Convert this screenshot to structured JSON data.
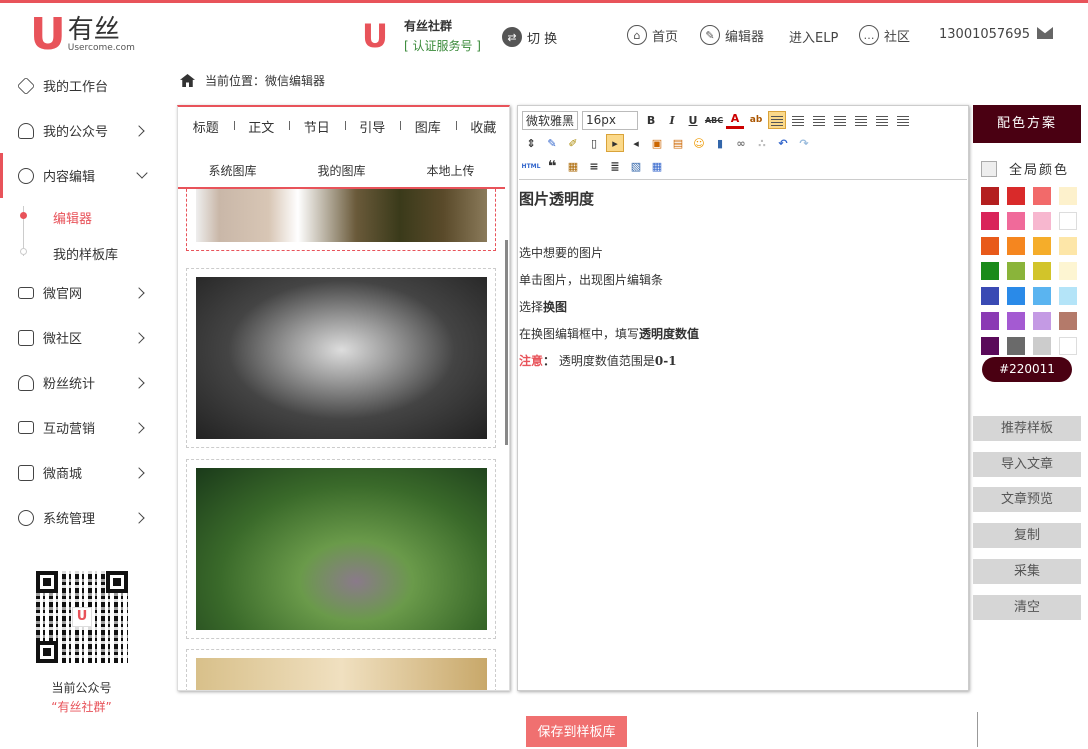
{
  "header": {
    "brand_cn": "有丝",
    "brand_en": "Usercome.com",
    "account_name": "有丝社群",
    "account_type": "[ 认证服务号 ]",
    "switch_label": "切 换",
    "nav": [
      "首页",
      "编辑器",
      "进入ELP",
      "社区"
    ],
    "phone": "13001057695",
    "accent": "#e8535a"
  },
  "sidebar": {
    "items": [
      {
        "label": "我的工作台",
        "icon": "layers-icon"
      },
      {
        "label": "我的公众号",
        "icon": "user-icon"
      },
      {
        "label": "内容编辑",
        "icon": "compass-icon"
      },
      {
        "label": "微官网",
        "icon": "monitor-icon"
      },
      {
        "label": "微社区",
        "icon": "copy-icon"
      },
      {
        "label": "粉丝统计",
        "icon": "users-icon"
      },
      {
        "label": "互动营销",
        "icon": "briefcase-icon"
      },
      {
        "label": "微商城",
        "icon": "store-icon"
      },
      {
        "label": "系统管理",
        "icon": "gear-icon"
      }
    ],
    "sub_items": [
      "编辑器",
      "我的样板库"
    ],
    "qr_caption": "当前公众号",
    "qr_account": "“有丝社群”"
  },
  "breadcrumb": "当前位置：微信编辑器",
  "left_panel": {
    "tabs": [
      "标题",
      "正文",
      "节日",
      "引导",
      "图库",
      "收藏"
    ],
    "subtabs": [
      "系统图库",
      "我的图库",
      "本地上传"
    ]
  },
  "toolbar": {
    "font": "微软雅黑",
    "size": "16px"
  },
  "editor": {
    "title": "图片透明度",
    "lines": [
      "选中想要的图片",
      "单击图片，出现图片编辑条"
    ],
    "line3_prefix": "选择",
    "line3_bold": "换图",
    "line4_prefix": "在换图编辑框中，填写",
    "line4_bold": "透明度数值",
    "note_label": "注意",
    "note_colon": "：",
    "note_text": "透明度数值范围是",
    "note_value": "0-1"
  },
  "color_scheme": {
    "title": "配色方案",
    "global_label": "全局颜色",
    "current_hex": "#220011",
    "swatches": [
      "#b41f1f",
      "#d92a2a",
      "#f26a6a",
      "#fdf1cc",
      "#d9245a",
      "#f06a9a",
      "#f7b7cf",
      "#ffffff",
      "#e85a1a",
      "#f5861f",
      "#f5ad2a",
      "#fde6a8",
      "#1a8a1a",
      "#8ab43a",
      "#d2c42a",
      "#fdf5d2",
      "#3a4ab4",
      "#2a8ae8",
      "#5ab4f0",
      "#b4e4f8",
      "#8a3ab4",
      "#a45ad2",
      "#c49ae4",
      "#b47a6a",
      "#5a0a5a",
      "#6a6a6a",
      "#cccccc",
      "#ffffff"
    ]
  },
  "actions": [
    "推荐样板",
    "导入文章",
    "文章预览",
    "复制",
    "采集",
    "清空"
  ],
  "save_button": "保存到样板库"
}
